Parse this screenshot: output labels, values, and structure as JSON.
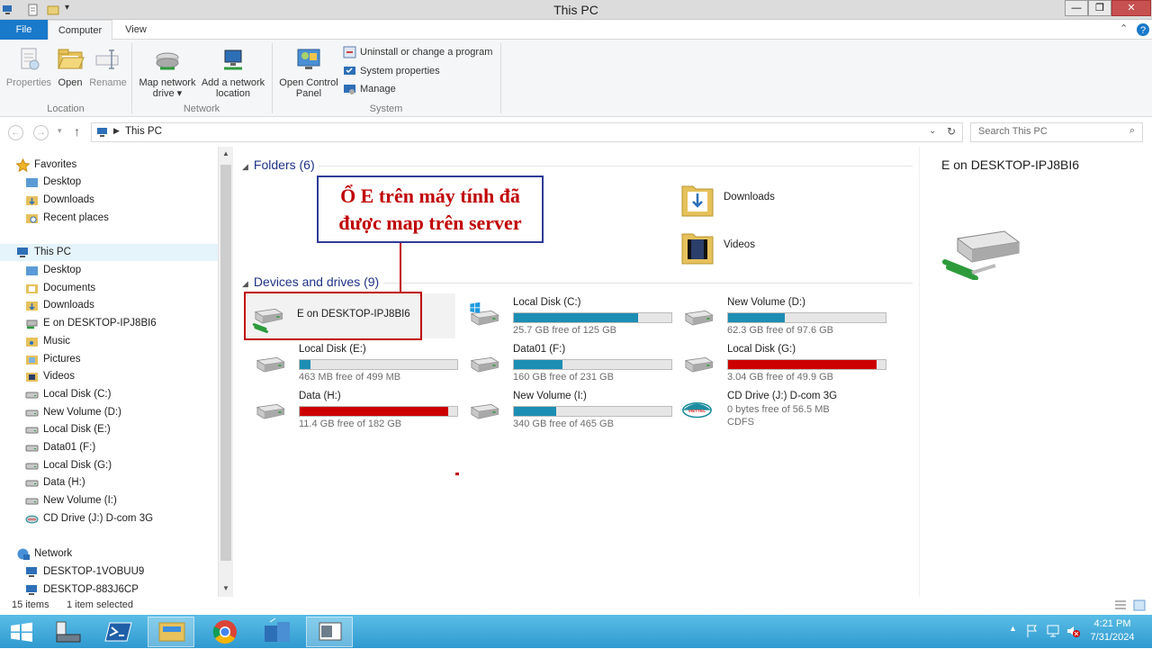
{
  "window": {
    "title": "This PC"
  },
  "ribbon": {
    "tabs": [
      "File",
      "Computer",
      "View"
    ],
    "buttons": {
      "properties": "Properties",
      "open": "Open",
      "rename": "Rename",
      "map_network_drive_line1": "Map network",
      "map_network_drive_line2": "drive ▾",
      "add_network_location_line1": "Add a network",
      "add_network_location_line2": "location",
      "open_control_panel_line1": "Open Control",
      "open_control_panel_line2": "Panel",
      "uninstall": "Uninstall or change a program",
      "system_properties": "System properties",
      "manage": "Manage"
    },
    "groups": {
      "location": "Location",
      "network": "Network",
      "system": "System"
    }
  },
  "address": {
    "path": "This PC",
    "search_placeholder": "Search This PC"
  },
  "nav": {
    "favorites": "Favorites",
    "fav_items": [
      "Desktop",
      "Downloads",
      "Recent places"
    ],
    "this_pc": "This PC",
    "pc_items": [
      "Desktop",
      "Documents",
      "Downloads",
      "E on DESKTOP-IPJ8BI6",
      "Music",
      "Pictures",
      "Videos",
      "Local Disk (C:)",
      "New Volume (D:)",
      "Local Disk (E:)",
      "Data01 (F:)",
      "Local Disk (G:)",
      "Data (H:)",
      "New Volume (I:)",
      "CD Drive (J:) D-com 3G"
    ],
    "network": "Network",
    "net_items": [
      "DESKTOP-1VOBUU9",
      "DESKTOP-883J6CP"
    ]
  },
  "content": {
    "folders_header": "Folders (6)",
    "devices_header": "Devices and drives (9)",
    "folders": [
      "Downloads",
      "Videos"
    ],
    "drives": [
      {
        "name": "E on DESKTOP-IPJ8BI6",
        "free": "",
        "used_fraction": null
      },
      {
        "name": "Local Disk (C:)",
        "free": "25.7 GB free of 125 GB",
        "used_fraction": 0.79
      },
      {
        "name": "New Volume (D:)",
        "free": "62.3 GB free of 97.6 GB",
        "used_fraction": 0.36
      },
      {
        "name": "Local Disk (E:)",
        "free": "463 MB free of 499 MB",
        "used_fraction": 0.07
      },
      {
        "name": "Data01 (F:)",
        "free": "160 GB free of 231 GB",
        "used_fraction": 0.31
      },
      {
        "name": "Local Disk (G:)",
        "free": "3.04 GB free of 49.9 GB",
        "used_fraction": 0.94
      },
      {
        "name": "Data (H:)",
        "free": "11.4 GB free of 182 GB",
        "used_fraction": 0.94
      },
      {
        "name": "New Volume (I:)",
        "free": "340 GB free of 465 GB",
        "used_fraction": 0.27
      },
      {
        "name": "CD Drive (J:) D-com 3G",
        "free": "0 bytes free of 56.5 MB",
        "fs": "CDFS",
        "used_fraction": null
      }
    ],
    "annotation_line1": "Ổ E trên máy tính đã",
    "annotation_line2": "được map trên server"
  },
  "preview": {
    "title": "E on DESKTOP-IPJ8BI6"
  },
  "status": {
    "items": "15 items",
    "selected": "1 item selected"
  },
  "taskbar": {
    "time": "4:21 PM",
    "date": "7/31/2024"
  },
  "colors": {
    "accent": "#1979ca",
    "bar_normal": "#1c8eb3",
    "bar_full": "#cc0000",
    "annotation": "#c00000"
  }
}
